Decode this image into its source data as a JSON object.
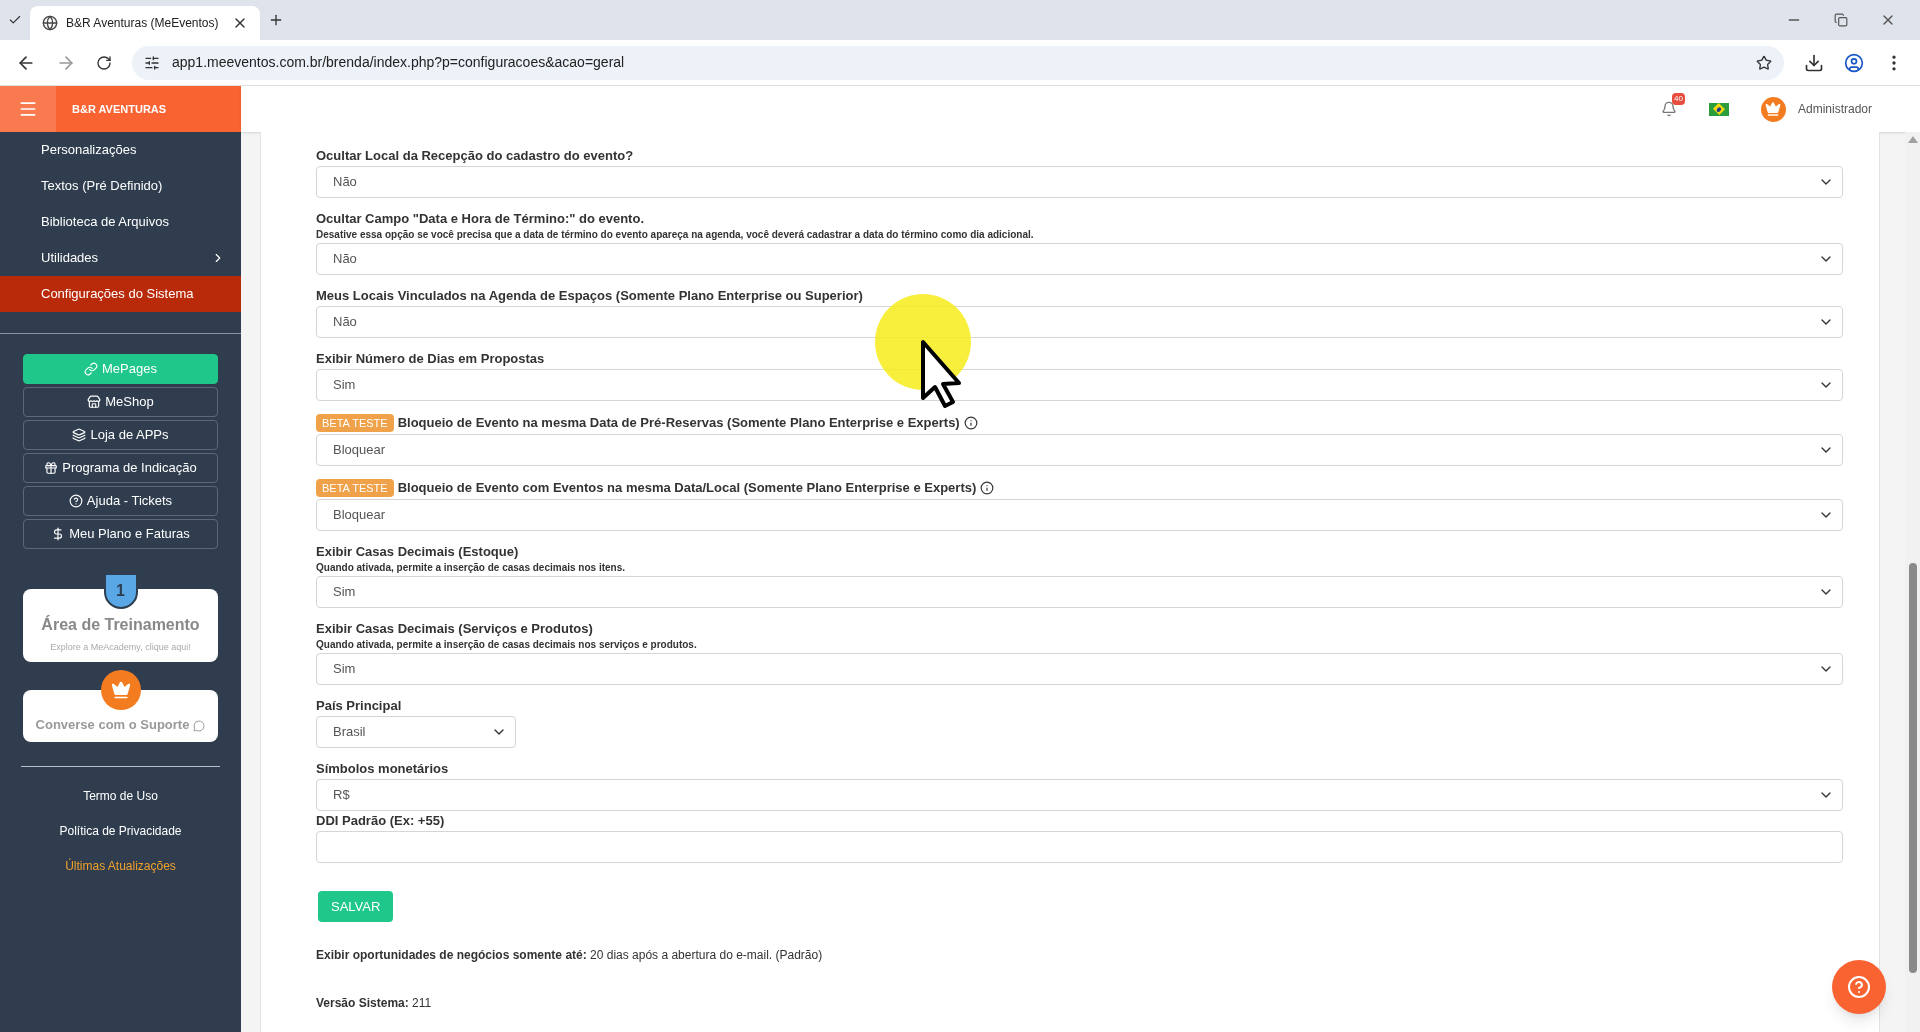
{
  "browser": {
    "tab_title": "B&R Aventuras (MeEventos)",
    "url": "app1.meeventos.com.br/brenda/index.php?p=configuracoes&acao=geral"
  },
  "header": {
    "brand": "B&R AVENTURAS",
    "notifications": "40",
    "user": "Administrador"
  },
  "sidebar": {
    "items": [
      {
        "label": "Personalizações",
        "selected": false,
        "has_submenu": false
      },
      {
        "label": "Textos (Pré Definido)",
        "selected": false,
        "has_submenu": false
      },
      {
        "label": "Biblioteca de Arquivos",
        "selected": false,
        "has_submenu": false
      },
      {
        "label": "Utilidades",
        "selected": false,
        "has_submenu": true
      },
      {
        "label": "Configurações do Sistema",
        "selected": true,
        "has_submenu": false
      }
    ],
    "buttons": [
      {
        "label": "MePages",
        "kind": "primary"
      },
      {
        "label": "MeShop",
        "kind": "outline"
      },
      {
        "label": "Loja de APPs",
        "kind": "outline"
      },
      {
        "label": "Programa de Indicação",
        "kind": "outline"
      },
      {
        "label": "Ajuda - Tickets",
        "kind": "outline"
      },
      {
        "label": "Meu Plano e Faturas",
        "kind": "outline"
      }
    ],
    "training_card": {
      "badge": "1",
      "title": "Área de Treinamento",
      "subtitle": "Explore a MeAcademy, clique aqui!"
    },
    "support_card": {
      "title": "Converse com o Suporte"
    },
    "footer_links": [
      {
        "label": "Termo de Uso",
        "color": "#ffffff"
      },
      {
        "label": "Política de Privacidade",
        "color": "#ffffff"
      },
      {
        "label": "Últimas Atualizações",
        "color": "#f0a12b"
      }
    ]
  },
  "form": {
    "fields": [
      {
        "label": "Ocultar Local da Recepção do cadastro do evento?",
        "kind": "select",
        "value": "Não"
      },
      {
        "label": "Ocultar Campo \"Data e Hora de Término:\" do evento.",
        "hint": "Desative essa opção se você precisa que a data de término do evento apareça na agenda, você deverá cadastrar a data do término como dia adicional.",
        "kind": "select",
        "value": "Não"
      },
      {
        "label": "Meus Locais Vinculados na Agenda de Espaços (Somente Plano Enterprise ou Superior)",
        "kind": "select",
        "value": "Não"
      },
      {
        "label": "Exibir Número de Dias em Propostas",
        "kind": "select",
        "value": "Sim"
      },
      {
        "badge": "BETA TESTE",
        "label": "Bloqueio de Evento na mesma Data de Pré-Reservas (Somente Plano Enterprise e Experts)",
        "info": true,
        "kind": "select",
        "value": "Bloquear"
      },
      {
        "badge": "BETA TESTE",
        "label": "Bloqueio de Evento com Eventos na mesma Data/Local (Somente Plano Enterprise e Experts)",
        "info": true,
        "kind": "select",
        "value": "Bloquear"
      },
      {
        "label": "Exibir Casas Decimais (Estoque)",
        "hint": "Quando ativada, permite a inserção de casas decimais nos itens.",
        "kind": "select",
        "value": "Sim"
      },
      {
        "label": "Exibir Casas Decimais (Serviços e Produtos)",
        "hint": "Quando ativada, permite a inserção de casas decimais nos serviços e produtos.",
        "kind": "select",
        "value": "Sim"
      },
      {
        "label": "País Principal",
        "kind": "compact-select",
        "value": "Brasil"
      },
      {
        "label": "Símbolos monetários",
        "kind": "select",
        "value": "R$"
      },
      {
        "label": "DDI Padrão (Ex: +55)",
        "kind": "text-input"
      }
    ],
    "save_button": "SALVAR",
    "notes": [
      "**Exibir oportunidades de negócios somente até:** 20 dias após a abertura do e-mail. (Padrão)",
      "**Versão Sistema:** 211"
    ]
  }
}
